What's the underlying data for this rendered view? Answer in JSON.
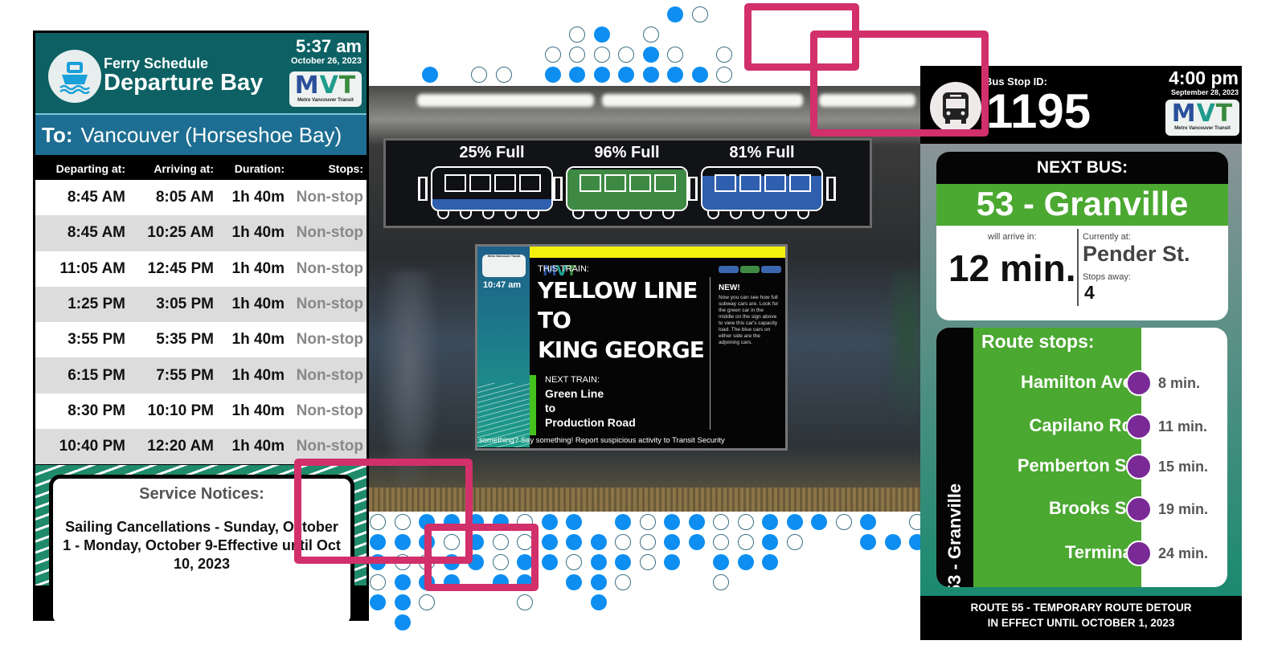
{
  "ferry": {
    "title_small": "Ferry Schedule",
    "title_large": "Departure Bay",
    "time": "5:37 am",
    "date": "October 26, 2023",
    "logo": {
      "letters": [
        "M",
        "V",
        "T"
      ],
      "caption": "Metro Vancouver Transit"
    },
    "destination_label": "To:",
    "destination": "Vancouver (Horseshoe Bay)",
    "columns": [
      "Departing at:",
      "Arriving at:",
      "Duration:",
      "Stops:"
    ],
    "rows": [
      {
        "depart": "8:45 AM",
        "arrive": "8:05 AM",
        "duration": "1h 40m",
        "stops": "Non-stop"
      },
      {
        "depart": "8:45 AM",
        "arrive": "10:25 AM",
        "duration": "1h 40m",
        "stops": "Non-stop"
      },
      {
        "depart": "11:05 AM",
        "arrive": "12:45 PM",
        "duration": "1h 40m",
        "stops": "Non-stop"
      },
      {
        "depart": "1:25 PM",
        "arrive": "3:05 PM",
        "duration": "1h 40m",
        "stops": "Non-stop"
      },
      {
        "depart": "3:55 PM",
        "arrive": "5:35 PM",
        "duration": "1h 40m",
        "stops": "Non-stop"
      },
      {
        "depart": "6:15 PM",
        "arrive": "7:55 PM",
        "duration": "1h 40m",
        "stops": "Non-stop"
      },
      {
        "depart": "8:30 PM",
        "arrive": "10:10 PM",
        "duration": "1h 40m",
        "stops": "Non-stop"
      },
      {
        "depart": "10:40 PM",
        "arrive": "12:20 AM",
        "duration": "1h 40m",
        "stops": "Non-stop"
      }
    ],
    "notices_title": "Service Notices:",
    "notice_text": "Sailing Cancellations - Sunday, October 1 - Monday, October 9-Effective until Oct 10, 2023"
  },
  "subway": {
    "cars": [
      {
        "label": "25% Full",
        "fill_pct": 25,
        "color": "#2f5fae"
      },
      {
        "label": "96% Full",
        "fill_pct": 96,
        "color": "#3e8a44"
      },
      {
        "label": "81% Full",
        "fill_pct": 81,
        "color": "#2f5fae"
      }
    ],
    "sign": {
      "time": "10:47 am",
      "this_train_label": "THIS TRAIN:",
      "this_train": [
        "YELLOW LINE",
        "TO",
        "KING GEORGE"
      ],
      "next_train_label": "NEXT TRAIN:",
      "next_train": [
        "Green Line",
        "to",
        "Production Road"
      ],
      "new_title": "NEW!",
      "new_text": "Now you can see how full subway cars are. Look for the green car in the middle on the sign above to view this car's capacity load. The blue cars on either side are the adjoining cars.",
      "ticker": "something? Say something! Report suspicious activity to Transit Security"
    }
  },
  "bus": {
    "stop_id_label": "Bus Stop ID:",
    "stop_id": "1195",
    "time": "4:00 pm",
    "date": "September 28, 2023",
    "next_bus_label": "NEXT BUS:",
    "route": "53 - Granville",
    "arrive_label": "will arrive in:",
    "arrive_value": "12 min.",
    "currently_label": "Currently at:",
    "currently_value": "Pender St.",
    "stops_away_label": "Stops away:",
    "stops_away_value": "4",
    "route_stops_label": "Route stops:",
    "stops": [
      {
        "name": "Hamilton Ave.",
        "time": "8 min."
      },
      {
        "name": "Capilano Rd.",
        "time": "11 min."
      },
      {
        "name": "Pemberton St.",
        "time": "15 min."
      },
      {
        "name": "Brooks St.",
        "time": "19 min."
      },
      {
        "name": "Terminal",
        "time": "24 min."
      }
    ],
    "footer": [
      "ROUTE  55 - TEMPORARY  ROUTE DETOUR",
      "IN EFFECT UNTIL OCTOBER 1, 2023"
    ]
  },
  "colors": {
    "dot_blue": "#0d8ef0",
    "highlight_pink": "#d1306a",
    "ferry_teal": "#0d6164",
    "bus_green": "#4ba831",
    "stop_purple": "#7a2a96"
  },
  "dot_patterns": {
    "top": [
      "..........fo.",
      "......of.o...",
      ".....oooofo.o",
      "f.oo.fffffffo"
    ],
    "bottom": [
      "ooffffoff foffoofffof ooff",
      "fffofoofffooffoofo  fffo",
      "fooffoffoffof fff",
      "offf.ff.ffo...o",
      "ffo...o..f",
      ".f"
    ]
  }
}
